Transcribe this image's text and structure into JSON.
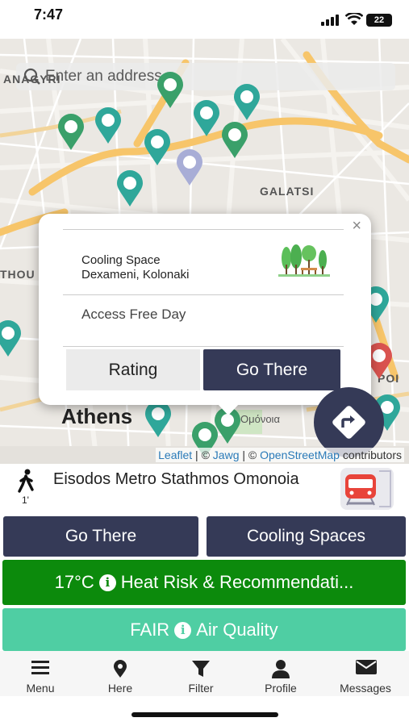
{
  "status_bar": {
    "time": "7:47",
    "battery": "22"
  },
  "map": {
    "search_placeholder": "Enter an address",
    "labels": [
      "ANAGYRI",
      "GALATSI",
      "THOU",
      "POI"
    ],
    "city_label": "Athens",
    "greek_label": "Ομόνοια",
    "attribution": {
      "leaflet": "Leaflet",
      "sep1": " | © ",
      "jawg": "Jawg",
      "sep2": " | © ",
      "osm": "OpenStreetMap",
      "suffix": " contributors"
    }
  },
  "popup": {
    "close": "×",
    "title_line1": "Cooling Space",
    "title_line2": "Dexameni, Kolonaki",
    "access": "Access Free Day",
    "rating_label": "Rating",
    "go_label": "Go There"
  },
  "transit": {
    "walk_minutes": "1'",
    "stop_name": "Eisodos Metro Stathmos Omonoia"
  },
  "actions": {
    "go_there": "Go There",
    "cooling_spaces": "Cooling Spaces",
    "heat_temp": "17°C",
    "heat_label": "Heat Risk & Recommendati...",
    "air_level": "FAIR",
    "air_label": "Air Quality",
    "info_glyph": "i"
  },
  "tabs": [
    {
      "label": "Menu",
      "icon": "menu-icon"
    },
    {
      "label": "Here",
      "icon": "location-pin-icon"
    },
    {
      "label": "Filter",
      "icon": "filter-icon"
    },
    {
      "label": "Profile",
      "icon": "user-icon"
    },
    {
      "label": "Messages",
      "icon": "envelope-icon"
    }
  ],
  "colors": {
    "navy": "#353a57",
    "heat_green": "#0c8a0c",
    "air_mint": "#4fcea3",
    "pin_teal": "#2fa79a",
    "pin_green": "#3aa06a",
    "pin_lavender": "#a8add6",
    "pin_red": "#d9534f"
  }
}
